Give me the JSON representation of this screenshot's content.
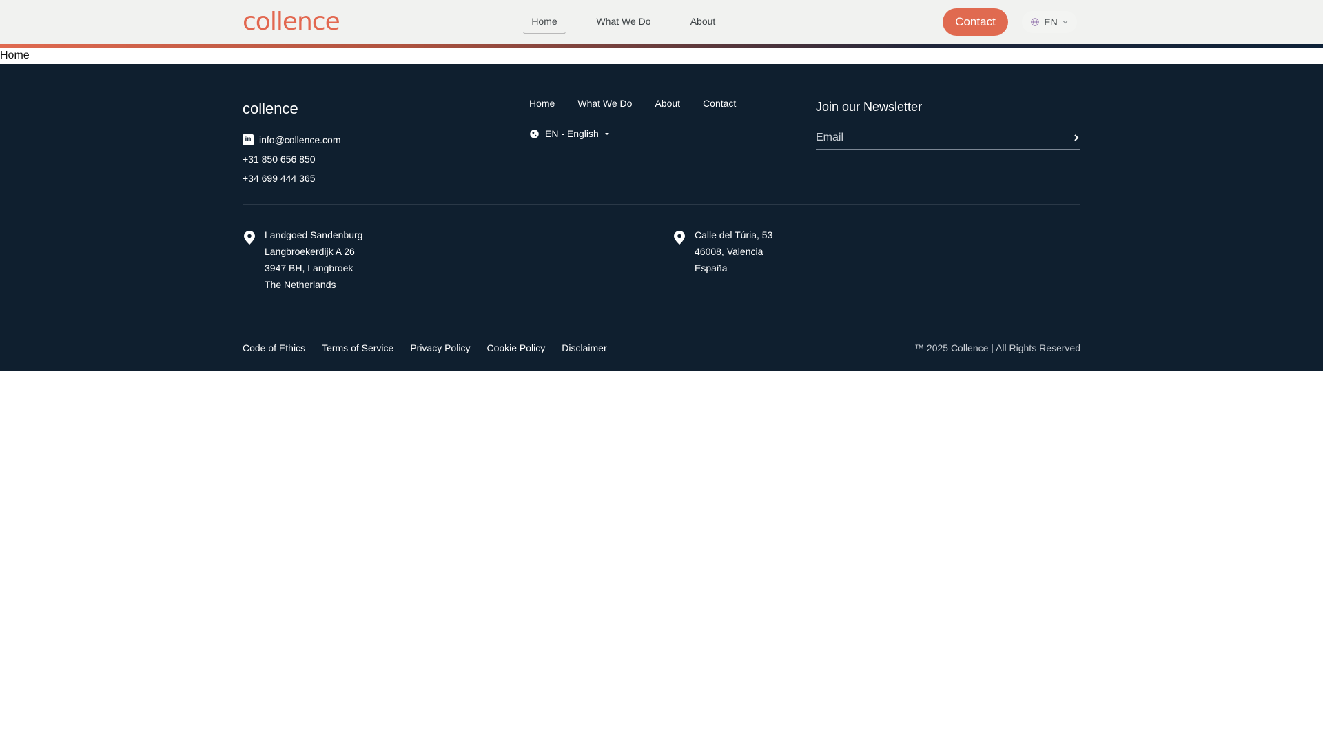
{
  "header": {
    "logo_text": "collence",
    "nav": [
      "Home",
      "What We Do",
      "About"
    ],
    "contact_button": "Contact",
    "language": "EN",
    "colors": {
      "accent": "#e06a50",
      "header_bg": "#f1f2f0"
    }
  },
  "breadcrumb": "Home",
  "footer": {
    "brand": "collence",
    "email": "info@collence.com",
    "phones": [
      "+31 850 656 850",
      "+34 699 444 365"
    ],
    "links": [
      "Home",
      "What We Do",
      "About",
      "Contact"
    ],
    "language_selector": "EN - English",
    "newsletter": {
      "title": "Join our Newsletter",
      "placeholder": "Email"
    },
    "addresses": [
      [
        "Landgoed Sandenburg",
        "Langbroekerdijk A 26",
        "3947 BH, Langbroek",
        "The Netherlands"
      ],
      [
        "Calle del Túria, 53",
        "46008, Valencia",
        "España"
      ]
    ],
    "legal_links": [
      "Code of Ethics",
      "Terms of Service",
      "Privacy Policy",
      "Cookie Policy",
      "Disclaimer"
    ],
    "copyright": "™ 2025 Collence | All Rights Reserved",
    "colors": {
      "background": "#0f1f2f"
    }
  }
}
